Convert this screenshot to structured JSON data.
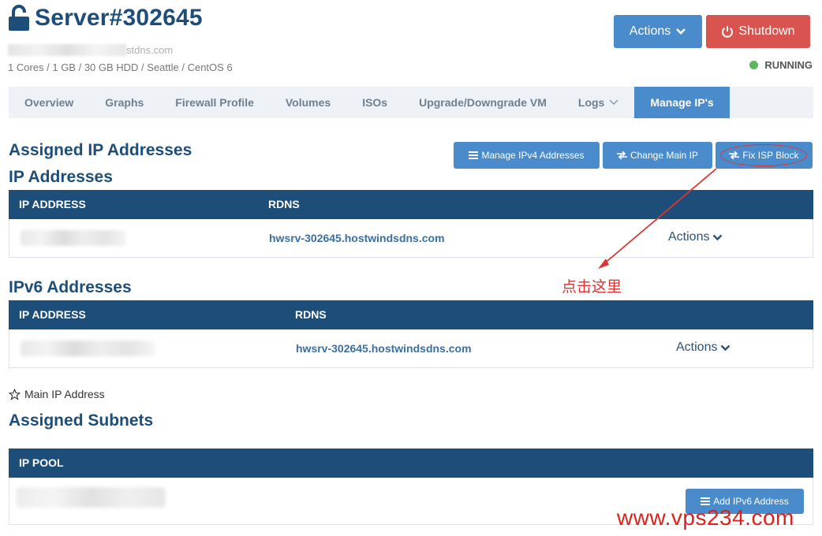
{
  "header": {
    "title": "Server#302645",
    "hostname_visible": "stdns.com",
    "specs": "1 Cores / 1 GB / 30 GB HDD / Seattle / CentOS 6",
    "status": "RUNNING",
    "status_color": "#5cb85c"
  },
  "toolbar": {
    "actions_label": "Actions",
    "shutdown_label": "Shutdown"
  },
  "tabs": [
    {
      "label": "Overview"
    },
    {
      "label": "Graphs"
    },
    {
      "label": "Firewall Profile"
    },
    {
      "label": "Volumes"
    },
    {
      "label": "ISOs"
    },
    {
      "label": "Upgrade/Downgrade VM"
    },
    {
      "label": "Logs"
    },
    {
      "label": "Manage IP's",
      "active": true
    }
  ],
  "assigned": {
    "heading": "Assigned IP Addresses",
    "ip_heading": "IP Addresses",
    "buttons": {
      "manage_ipv4": "Manage IPv4 Addresses",
      "change_main": "Change Main IP",
      "fix_isp": "Fix ISP Block"
    }
  },
  "ipv4_table": {
    "col_ip": "IP ADDRESS",
    "col_rdns": "RDNS",
    "rows": [
      {
        "ip_partial": "169.140.23",
        "rdns": "hwsrv-302645.hostwindsdns.com",
        "actions": "Actions"
      }
    ]
  },
  "ipv6": {
    "heading": "IPv6 Addresses",
    "col_ip": "IP ADDRESS",
    "col_rdns": "RDNS",
    "rows": [
      {
        "ip_partial": "2(",
        "rdns": "hwsrv-302645.hostwindsdns.com",
        "actions": "Actions"
      }
    ]
  },
  "legend": {
    "main_ip": "Main IP Address"
  },
  "subnets": {
    "heading": "Assigned Subnets",
    "col_pool": "IP POOL",
    "add_ipv6": "Add IPv6 Address"
  },
  "annotation": {
    "text": "点击这里",
    "color": "#d33"
  },
  "watermark": "www.vps234.com",
  "colors": {
    "primary": "#4a8bcb",
    "header_dark": "#1d4e7a",
    "danger": "#d9534f"
  }
}
